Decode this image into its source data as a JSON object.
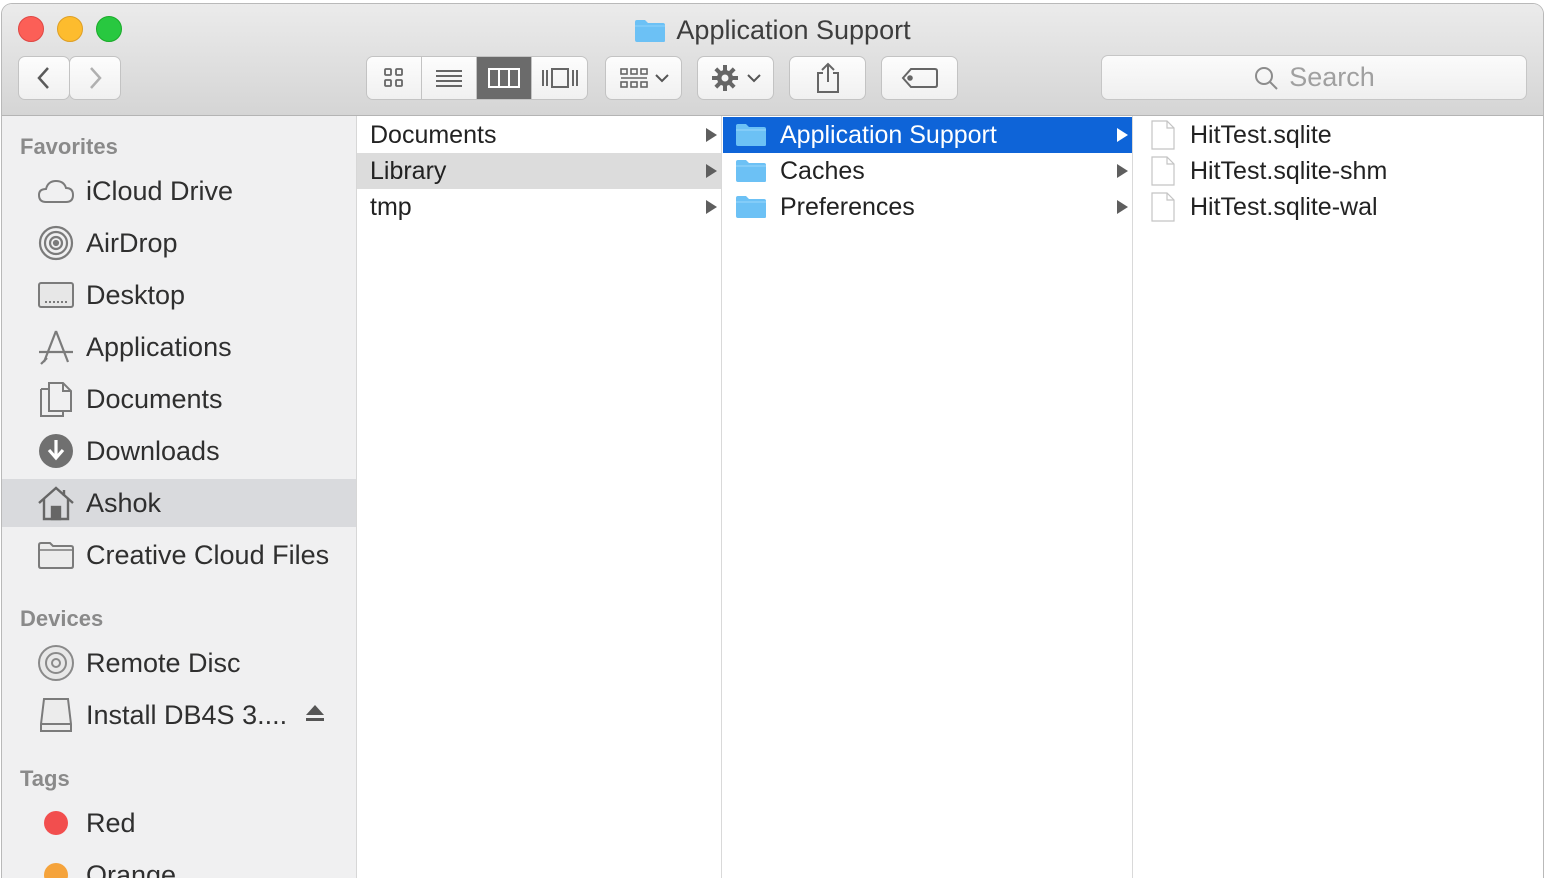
{
  "window": {
    "title": "Application Support"
  },
  "toolbar": {
    "search_placeholder": "Search",
    "icons": [
      "chevron-left-icon",
      "chevron-right-icon",
      "icon-view-icon",
      "list-view-icon",
      "column-view-icon",
      "cover-flow-icon",
      "group-icon",
      "gear-icon",
      "share-icon",
      "tag-icon",
      "search-icon"
    ]
  },
  "sidebar": {
    "favorites_header": "Favorites",
    "favorites": [
      {
        "label": "iCloud Drive",
        "icon": "cloud-icon"
      },
      {
        "label": "AirDrop",
        "icon": "airdrop-icon"
      },
      {
        "label": "Desktop",
        "icon": "desktop-icon"
      },
      {
        "label": "Applications",
        "icon": "applications-icon"
      },
      {
        "label": "Documents",
        "icon": "documents-icon"
      },
      {
        "label": "Downloads",
        "icon": "downloads-icon"
      },
      {
        "label": "Ashok",
        "icon": "home-icon",
        "selected": true
      },
      {
        "label": "Creative Cloud Files",
        "icon": "folder-icon"
      }
    ],
    "devices_header": "Devices",
    "devices": [
      {
        "label": "Remote Disc",
        "icon": "disc-icon"
      },
      {
        "label": "Install DB4S 3....",
        "icon": "drive-icon",
        "eject": true
      }
    ],
    "tags_header": "Tags",
    "tags": [
      {
        "label": "Red",
        "color": "#f24e4e"
      },
      {
        "label": "Orange",
        "color": "#f5a33b"
      }
    ]
  },
  "columns": {
    "col1": [
      {
        "label": "Documents",
        "arrow": true
      },
      {
        "label": "Library",
        "arrow": true,
        "highlight": "gray"
      },
      {
        "label": "tmp",
        "arrow": true
      }
    ],
    "col2": [
      {
        "label": "Application Support",
        "arrow": true,
        "highlight": "blue"
      },
      {
        "label": "Caches",
        "arrow": true
      },
      {
        "label": "Preferences",
        "arrow": true
      }
    ],
    "col3": [
      {
        "label": "HitTest.sqlite"
      },
      {
        "label": "HitTest.sqlite-shm"
      },
      {
        "label": "HitTest.sqlite-wal"
      }
    ]
  },
  "colors": {
    "selection_blue": "#0e64d8",
    "folder_blue": "#6cc1f5"
  }
}
